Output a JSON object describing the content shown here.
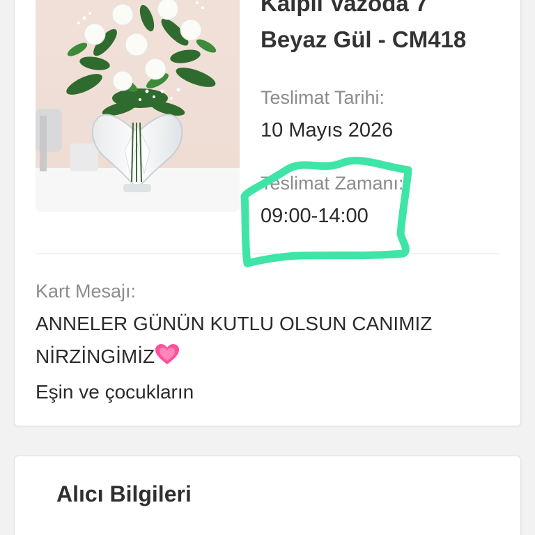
{
  "product": {
    "title_line1": "Kalpli Vazoda 7",
    "title_line2": "Beyaz Gül - CM418",
    "image_alt": "7 white roses in heart-shaped glass vase"
  },
  "delivery": {
    "date_label": "Teslimat Tarihi:",
    "date_value": "10 Mayıs 2026",
    "time_label": "Teslimat Zamanı:",
    "time_value": "09:00-14:00"
  },
  "card_message": {
    "label": "Kart Mesajı:",
    "line1": "ANNELER GÜNÜN KUTLU OLSUN CANIMIZ",
    "line2": "NİRZİNGİMİZ",
    "line3": "Eşin ve çocukların"
  },
  "recipient": {
    "title": "Alıcı Bilgileri"
  },
  "colors": {
    "highlight_stroke": "#3fe5a6",
    "heart": "#ff4f9a",
    "text_primary": "#2b2b2b",
    "text_muted": "#8c8c8c"
  },
  "icons": {
    "heart": "growing-heart-emoji"
  }
}
